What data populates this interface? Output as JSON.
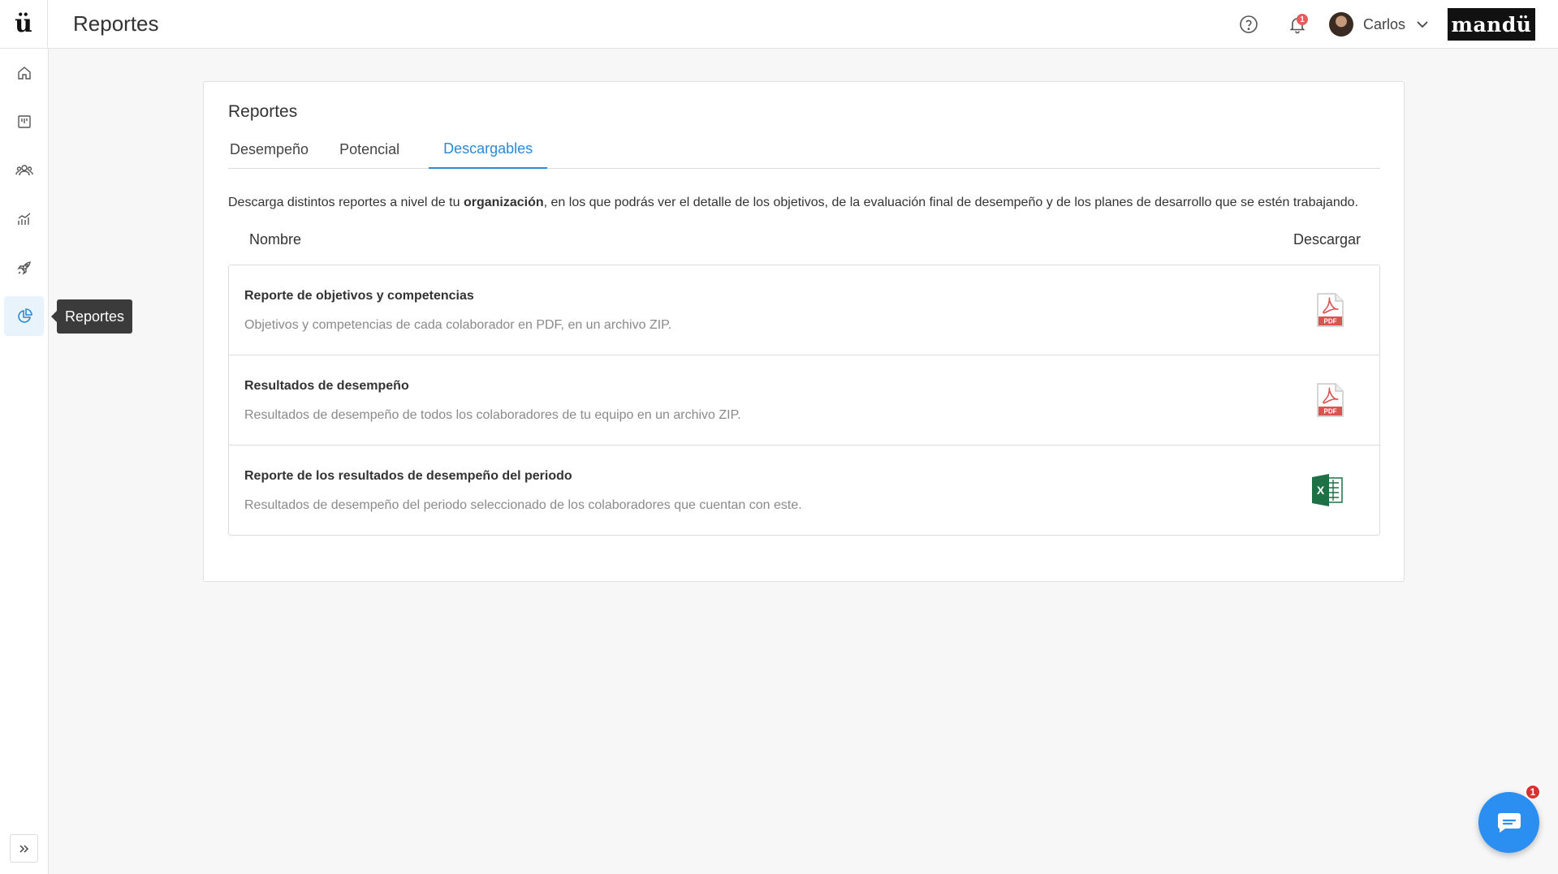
{
  "app": {
    "logo_text": "ü",
    "page_title": "Reportes",
    "brand": "mandü"
  },
  "header": {
    "notifications_count": "1",
    "user_name": "Carlos"
  },
  "sidebar": {
    "items": [
      {
        "icon": "home-icon"
      },
      {
        "icon": "board-icon"
      },
      {
        "icon": "people-icon"
      },
      {
        "icon": "chart-icon"
      },
      {
        "icon": "rocket-icon"
      },
      {
        "icon": "pie-chart-icon",
        "active": true
      }
    ],
    "tooltip": "Reportes"
  },
  "main": {
    "title": "Reportes",
    "tabs": [
      {
        "label": "Desempeño"
      },
      {
        "label": "Potencial"
      },
      {
        "label": "Descargables",
        "active": true
      }
    ],
    "description_before": "Descarga distintos reportes a nivel de tu ",
    "description_bold": "organización",
    "description_after": ", en los que podrás ver el detalle de los objetivos, de la evaluación final de desempeño y de los planes de desarrollo que se estén trabajando.",
    "table": {
      "col_name": "Nombre",
      "col_download": "Descargar",
      "rows": [
        {
          "title": "Reporte de objetivos y competencias",
          "description": "Objetivos y competencias de cada colaborador en PDF, en un archivo ZIP.",
          "file_type": "PDF"
        },
        {
          "title": "Resultados de desempeño",
          "description": "Resultados de desempeño de todos los colaboradores de tu equipo en un archivo ZIP.",
          "file_type": "PDF"
        },
        {
          "title": "Reporte de los resultados de desempeño del periodo",
          "description": "Resultados de desempeño del periodo seleccionado de los colaboradores que cuentan con este.",
          "file_type": "X"
        }
      ]
    }
  },
  "chat": {
    "badge_count": "1"
  },
  "colors": {
    "accent": "#2a8ad6",
    "notification": "#e85c5c",
    "pdf_red": "#d9534f",
    "excel_green": "#1e7145"
  }
}
